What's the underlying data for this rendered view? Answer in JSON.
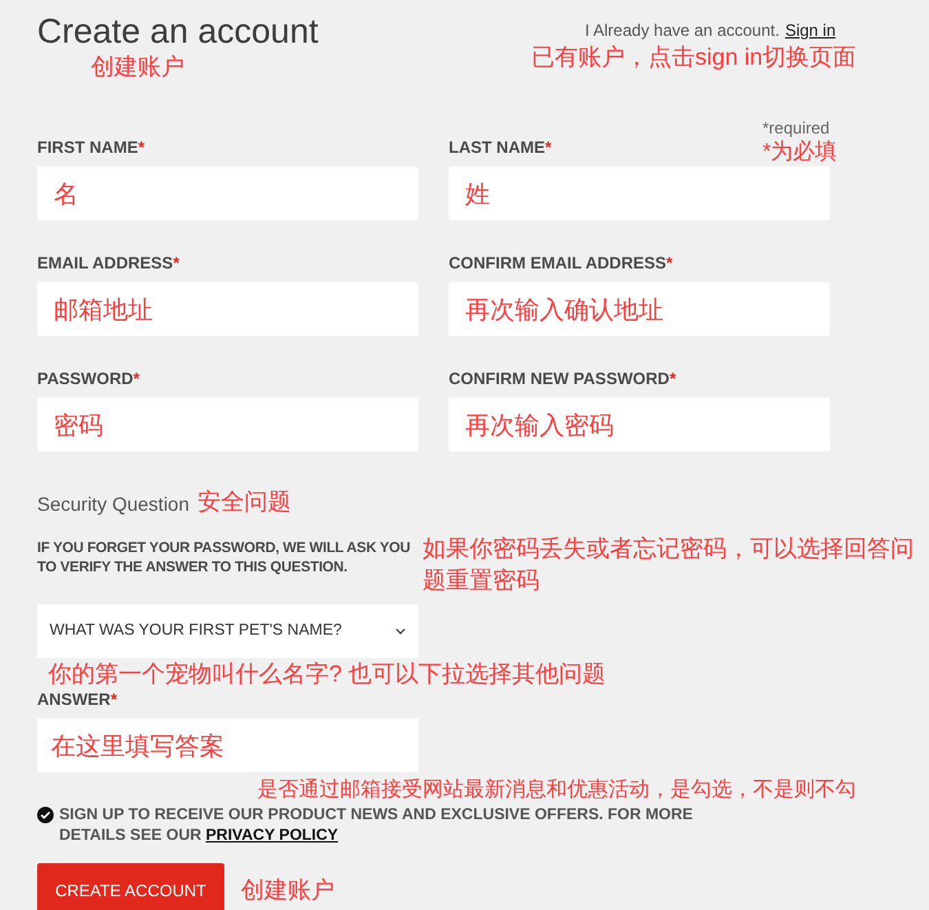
{
  "title": "Create an account",
  "title_note": "创建账户",
  "signin": {
    "prompt": "I Already have an account.",
    "link": "Sign in",
    "note": "已有账户，点击sign in切换页面"
  },
  "required": {
    "text": "*required",
    "note": "*为必填"
  },
  "fields": [
    {
      "label": "FIRST NAME",
      "mark": "*",
      "note": "名"
    },
    {
      "label": "LAST NAME",
      "mark": "*",
      "note": "姓"
    },
    {
      "label": "EMAIL ADDRESS",
      "mark": "*",
      "note": "邮箱地址"
    },
    {
      "label": "CONFIRM EMAIL ADDRESS",
      "mark": "*",
      "note": "再次输入确认地址"
    },
    {
      "label": "PASSWORD",
      "mark": "*",
      "note": "密码"
    },
    {
      "label": "CONFIRM NEW PASSWORD",
      "mark": "*",
      "note": "再次输入密码"
    }
  ],
  "security": {
    "heading": "Security Question",
    "heading_note": "安全问题",
    "info": "IF YOU FORGET YOUR PASSWORD, WE WILL ASK YOU TO VERIFY THE ANSWER TO THIS QUESTION.",
    "info_note": "如果你密码丢失或者忘记密码，可以选择回答问题重置密码",
    "select": "WHAT WAS YOUR FIRST PET'S NAME?",
    "select_note": "你的第一个宠物叫什么名字? 也可以下拉选择其他问题",
    "answer_label": "ANSWER",
    "answer_mark": "*",
    "answer_note": "在这里填写答案"
  },
  "newsletter": {
    "checked": true,
    "text": "SIGN UP TO RECEIVE OUR PRODUCT NEWS AND EXCLUSIVE OFFERS. FOR MORE DETAILS SEE OUR",
    "link": "PRIVACY POLICY",
    "note": "是否通过邮箱接受网站最新消息和优惠活动，是勾选，不是则不勾"
  },
  "button": {
    "label": "CREATE ACCOUNT",
    "note": "创建账户"
  }
}
